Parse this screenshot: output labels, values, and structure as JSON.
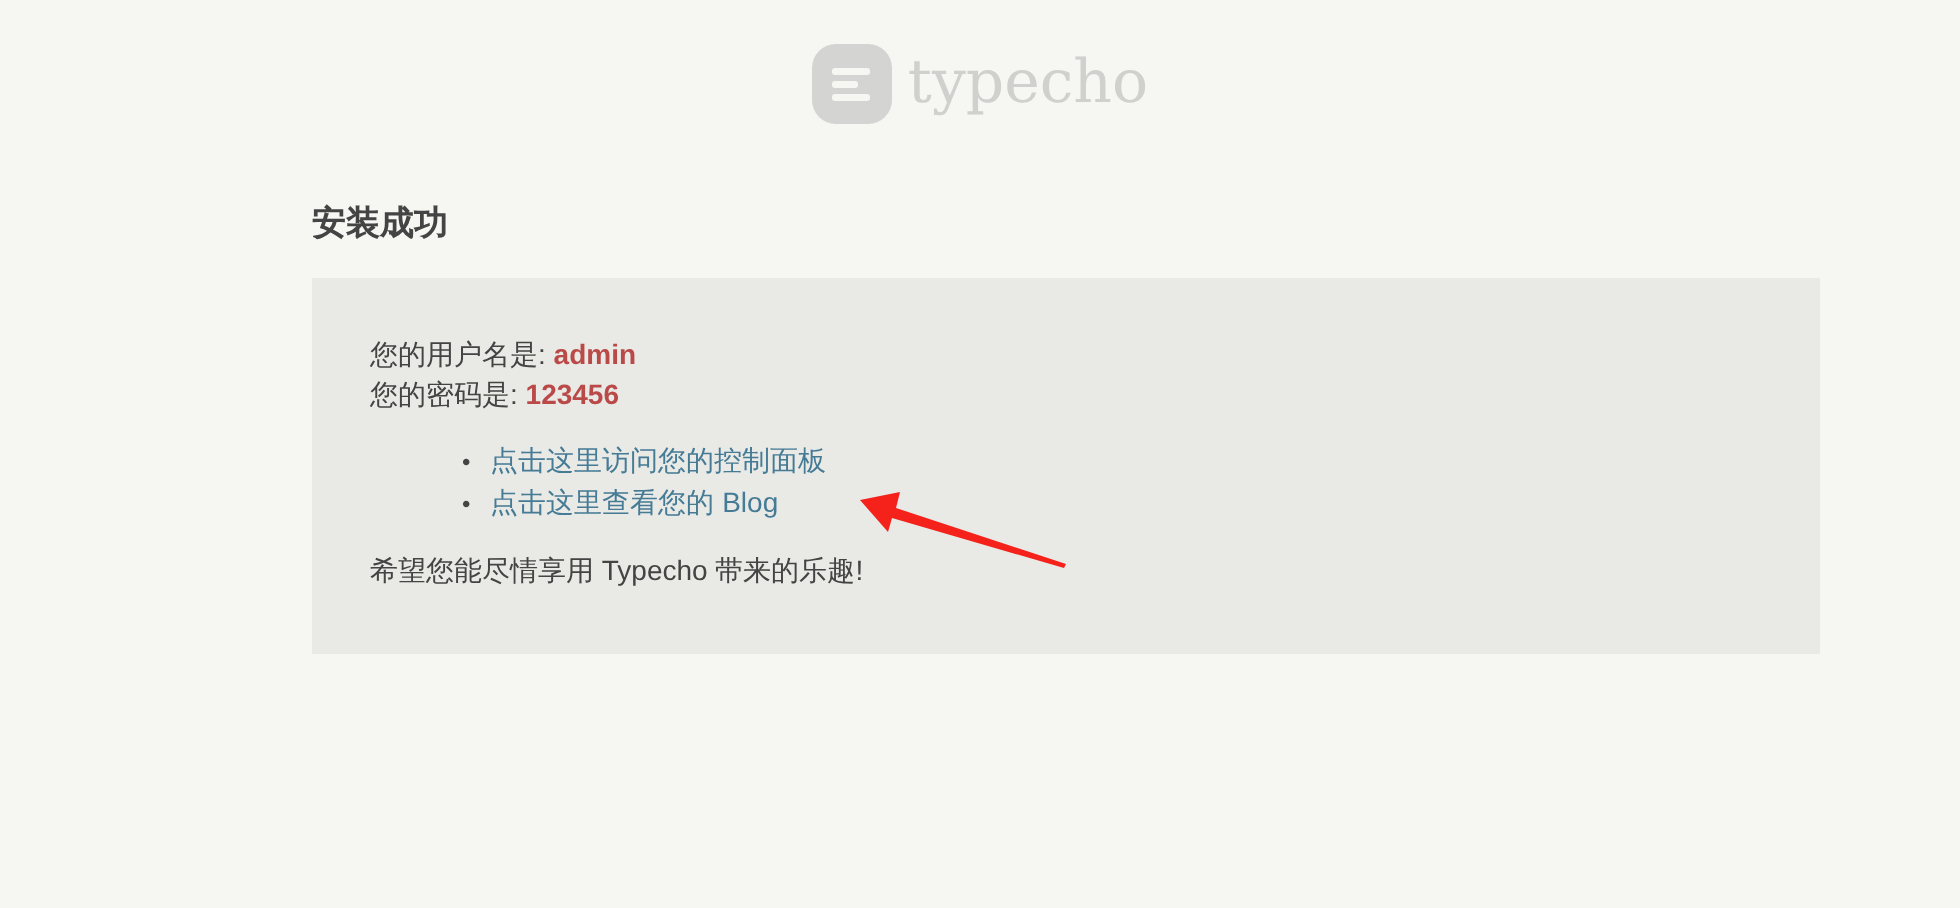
{
  "logo": {
    "text": "typecho"
  },
  "title": "安装成功",
  "credentials": [
    {
      "label": "您的用户名是: ",
      "value": "admin"
    },
    {
      "label": "您的密码是: ",
      "value": "123456"
    }
  ],
  "links": [
    {
      "bullet": "•",
      "text": "点击这里访问您的控制面板"
    },
    {
      "bullet": "•",
      "text": "点击这里查看您的 Blog"
    }
  ],
  "message": "希望您能尽情享用 Typecho 带来的乐趣!"
}
